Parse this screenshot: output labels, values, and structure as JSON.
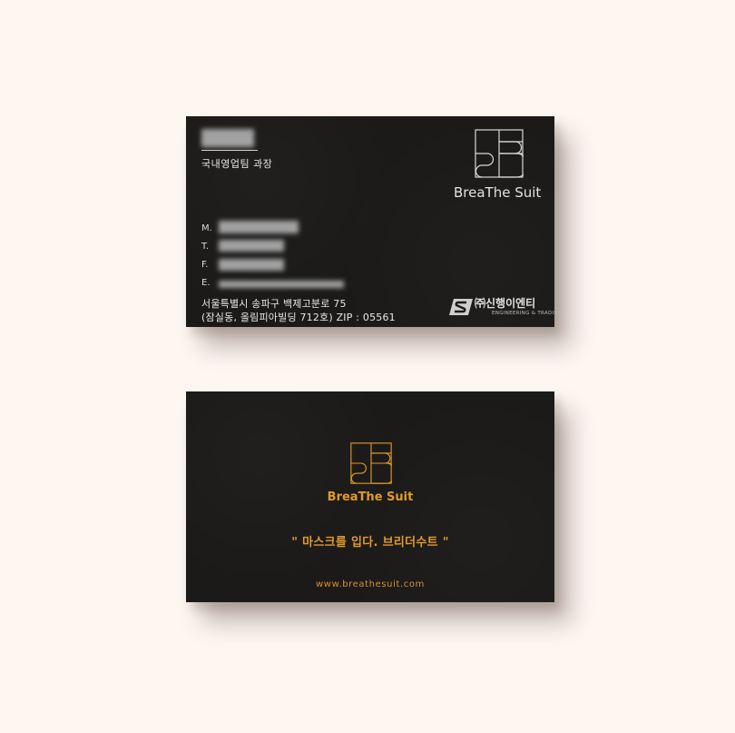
{
  "front": {
    "title": "국내영업팀 과장",
    "contact_labels": [
      "M.",
      "T.",
      "F.",
      "E."
    ],
    "brand": "BreaThe Suit",
    "address_line1": "서울특별시 송파구 백제고분로 75",
    "address_line2": "(잠실동, 올림피아빌딩 712호) ZIP : 05561",
    "company_name": "㈜신행이엔티",
    "company_sub": "ENGINEERING & TRADING"
  },
  "back": {
    "brand": "BreaThe Suit",
    "slogan": "\" 마스크를 입다. 브리더수트 \"",
    "url": "www.breathesuit.com"
  },
  "colors": {
    "card": "#1b1a19",
    "gold": "#e19a2a",
    "background": "#fdf6f1"
  }
}
